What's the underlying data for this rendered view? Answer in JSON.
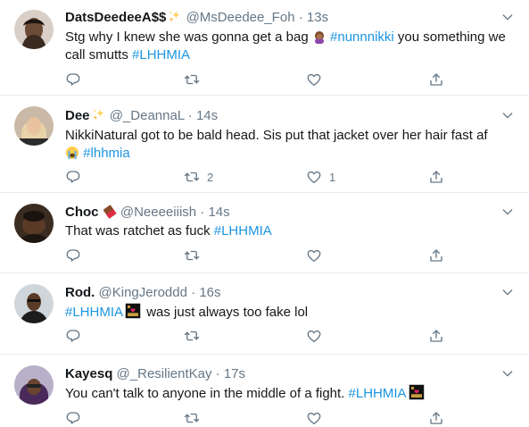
{
  "tweets": [
    {
      "name": "DatsDeedeeA$$",
      "handle": "@MsDeedee_Foh",
      "dot": "·",
      "time": "13s",
      "text_a": "Stg why I  knew she was gonna get a bag",
      "hashtag_1": "#nunnnikki",
      "text_b": " you something we call smutts ",
      "hashtag_2": "#LHHMIA",
      "retweets": "",
      "likes": ""
    },
    {
      "name": "Dee",
      "handle": "@_DeannaL",
      "dot": "·",
      "time": "14s",
      "text_a": "NikkiNatural got to be bald head. Sis put that jacket over her hair fast af",
      "hashtag_1": "#lhhmia",
      "retweets": "2",
      "likes": "1"
    },
    {
      "name": "Choc",
      "handle": "@Neeeeiiish",
      "dot": "·",
      "time": "14s",
      "text_a": "That was ratchet as fuck ",
      "hashtag_1": "#LHHMIA",
      "retweets": "",
      "likes": ""
    },
    {
      "name": "Rod.",
      "handle": "@KingJeroddd",
      "dot": "·",
      "time": "16s",
      "hashtag_1": "#LHHMIA",
      "text_a": " was just always too fake lol",
      "retweets": "",
      "likes": ""
    },
    {
      "name": "Kayesq",
      "handle": "@_ResilientKay",
      "dot": "·",
      "time": "17s",
      "text_a": "You can't talk to anyone in the middle of a fight. ",
      "hashtag_1": "#LHHMIA",
      "retweets": "",
      "likes": ""
    }
  ],
  "colors": {
    "link": "#1b95e0",
    "muted": "#657786",
    "divider": "#e6ecf0"
  },
  "icons": [
    "reply-icon",
    "retweet-icon",
    "like-icon",
    "share-icon",
    "chevron-down-icon"
  ]
}
